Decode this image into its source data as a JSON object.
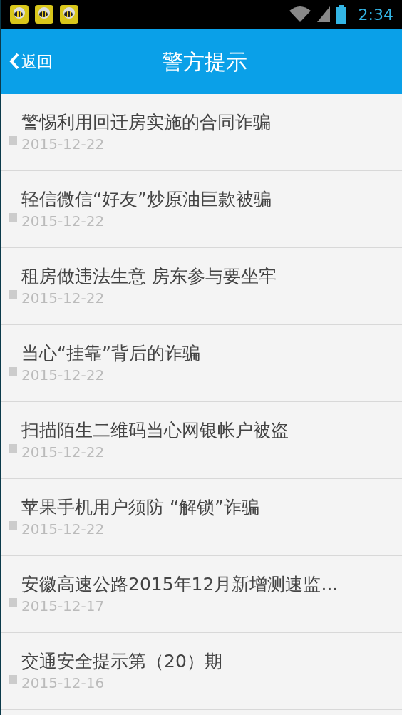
{
  "status_bar": {
    "time": "2:34",
    "notifications": [
      {
        "kind": "app"
      },
      {
        "kind": "app"
      },
      {
        "kind": "app"
      }
    ]
  },
  "header": {
    "back": "返回",
    "title": "警方提示"
  },
  "items": [
    {
      "title": "警惕利用回迁房实施的合同诈骗",
      "date": "2015-12-22"
    },
    {
      "title": "轻信微信“好友”炒原油巨款被骗",
      "date": "2015-12-22"
    },
    {
      "title": "租房做违法生意 房东参与要坐牢",
      "date": "2015-12-22"
    },
    {
      "title": "当心“挂靠”背后的诈骗",
      "date": "2015-12-22"
    },
    {
      "title": "扫描陌生二维码当心网银帐户被盗",
      "date": "2015-12-22"
    },
    {
      "title": "苹果手机用户须防 “解锁”诈骗",
      "date": "2015-12-22"
    },
    {
      "title": "安徽高速公路2015年12月新增测速监...",
      "date": "2015-12-17"
    },
    {
      "title": "交通安全提示第（20）期",
      "date": "2015-12-16"
    }
  ]
}
